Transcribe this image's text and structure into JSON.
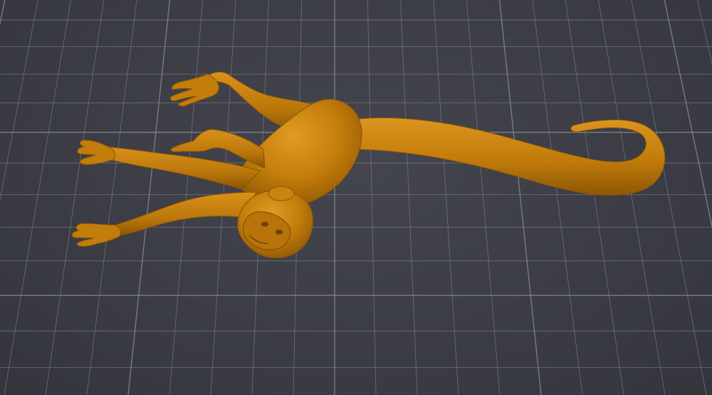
{
  "viewport": {
    "background_color": "#3c3d45",
    "grid_color": "#8e8f98",
    "model_color": "#c27d0a",
    "model_shadow_color": "#8a5404",
    "model_highlight_color": "#e29a22",
    "model_subject": "monkey-3d-model"
  }
}
